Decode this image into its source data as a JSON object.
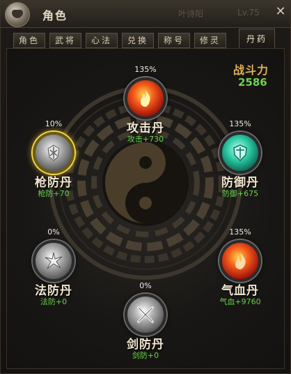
{
  "window": {
    "title": "角色",
    "ghost_name": "叶诗阳",
    "ghost_level": "Lv.75",
    "close_symbol": "✕"
  },
  "tabs": [
    {
      "label": "角色",
      "active": false
    },
    {
      "label": "武将",
      "active": false
    },
    {
      "label": "心法",
      "active": false
    },
    {
      "label": "兑换",
      "active": false
    },
    {
      "label": "称号",
      "active": false
    },
    {
      "label": "修灵",
      "active": false
    },
    {
      "label": "丹药",
      "active": true
    }
  ],
  "combat_power": {
    "label": "战斗力",
    "value": "2586"
  },
  "pills": {
    "attack": {
      "percent": "135%",
      "name": "攻击丹",
      "bonus": "攻击+730",
      "icon": "fire-icon",
      "color": "#f25a1a"
    },
    "defense": {
      "percent": "135%",
      "name": "防御丹",
      "bonus": "防御+675",
      "icon": "shield-gem-icon",
      "color": "#29c6a0"
    },
    "spear": {
      "percent": "10%",
      "name": "枪防丹",
      "bonus": "枪防+70",
      "icon": "spear-shield-icon",
      "color": "#f0d84a"
    },
    "vitality": {
      "percent": "135%",
      "name": "气血丹",
      "bonus": "气血+9760",
      "icon": "blood-flame-icon",
      "color": "#e03a1a"
    },
    "magic": {
      "percent": "0%",
      "name": "法防丹",
      "bonus": "法防+0",
      "icon": "magic-burst-icon",
      "color": "#a9a9a9"
    },
    "sword": {
      "percent": "0%",
      "name": "剑防丹",
      "bonus": "剑防+0",
      "icon": "crossed-swords-icon",
      "color": "#a9a9a9"
    }
  }
}
